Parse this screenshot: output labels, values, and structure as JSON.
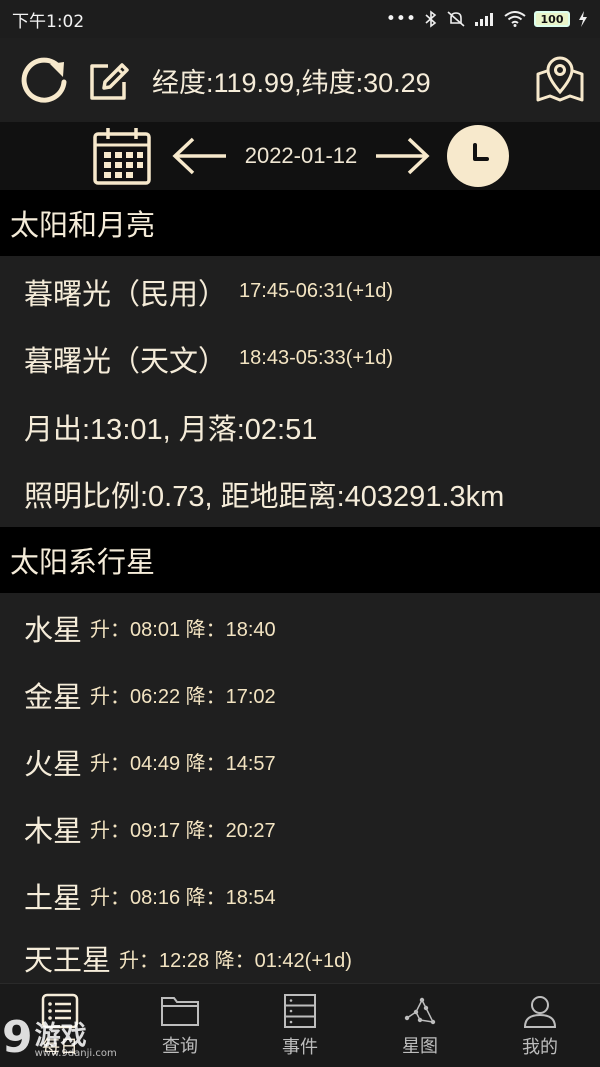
{
  "status_bar": {
    "time": "下午1:02",
    "battery": "100"
  },
  "header": {
    "coords": "经度:119.99,纬度:30.29"
  },
  "date_bar": {
    "date": "2022-01-12"
  },
  "sections": {
    "sun_moon": {
      "title": "太阳和月亮",
      "twilight_civil_label": "暮曙光（民用）",
      "twilight_civil_value": "17:45-06:31(+1d)",
      "twilight_astro_label": "暮曙光（天文）",
      "twilight_astro_value": "18:43-05:33(+1d)",
      "moon_rise_set": "月出:13:01, 月落:02:51",
      "illumination": "照明比例:0.73, 距地距离:403291.3km"
    },
    "planets": {
      "title": "太阳系行星",
      "items": [
        {
          "name": "水星",
          "times": "升：08:01 降：18:40"
        },
        {
          "name": "金星",
          "times": "升：06:22 降：17:02"
        },
        {
          "name": "火星",
          "times": "升：04:49 降：14:57"
        },
        {
          "name": "木星",
          "times": "升：09:17 降：20:27"
        },
        {
          "name": "土星",
          "times": "升：08:16 降：18:54"
        },
        {
          "name": "天王星",
          "times": "升：12:28 降：01:42(+1d)"
        }
      ]
    }
  },
  "bottom_nav": {
    "items": [
      {
        "label": "每日",
        "icon": "daily-list-icon"
      },
      {
        "label": "查询",
        "icon": "folder-icon"
      },
      {
        "label": "事件",
        "icon": "events-stack-icon"
      },
      {
        "label": "星图",
        "icon": "constellation-icon"
      },
      {
        "label": "我的",
        "icon": "user-icon"
      }
    ]
  },
  "watermark": {
    "logo_digit": "9",
    "logo_text": "游戏",
    "logo_url": "www.9danji.com"
  },
  "colors": {
    "accent": "#f7e9cc",
    "text": "#f5ecd9",
    "section_bg": "#000000",
    "page_bg": "#1f1f1f"
  }
}
